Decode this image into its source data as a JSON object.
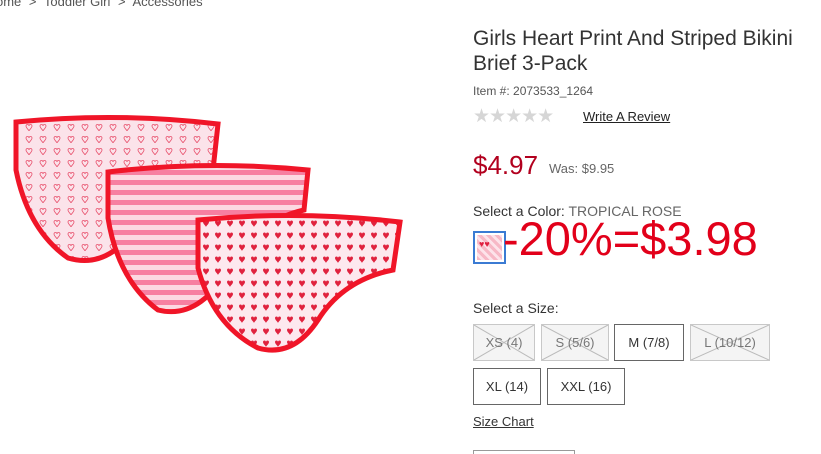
{
  "breadcrumb": {
    "items": [
      "ome",
      "Toddler Girl",
      "Accessories"
    ],
    "separator": ">"
  },
  "product": {
    "title": "Girls Heart Print And Striped Bikini Brief 3-Pack",
    "item_number": "Item #: 2073533_1264",
    "rating": {
      "stars": 0,
      "max": 5,
      "glyphs": "★★★★★"
    },
    "review_link": "Write A Review",
    "price": "$4.97",
    "was_price": "Was: $9.95"
  },
  "color": {
    "label": "Select a Color:",
    "selected": "TROPICAL ROSE"
  },
  "promo_annotation": "-20%=$3.98",
  "size": {
    "label": "Select a Size:",
    "options": [
      {
        "label": "XS (4)",
        "available": false
      },
      {
        "label": "S (5/6)",
        "available": false
      },
      {
        "label": "M (7/8)",
        "available": true
      },
      {
        "label": "L (10/12)",
        "available": false
      },
      {
        "label": "XL (14)",
        "available": true
      },
      {
        "label": "XXL (16)",
        "available": true
      }
    ]
  },
  "size_chart_link": "Size Chart",
  "colors": {
    "price_red": "#b2001e",
    "promo_red": "#e2001a",
    "swatch_border": "#3b7bd3"
  }
}
